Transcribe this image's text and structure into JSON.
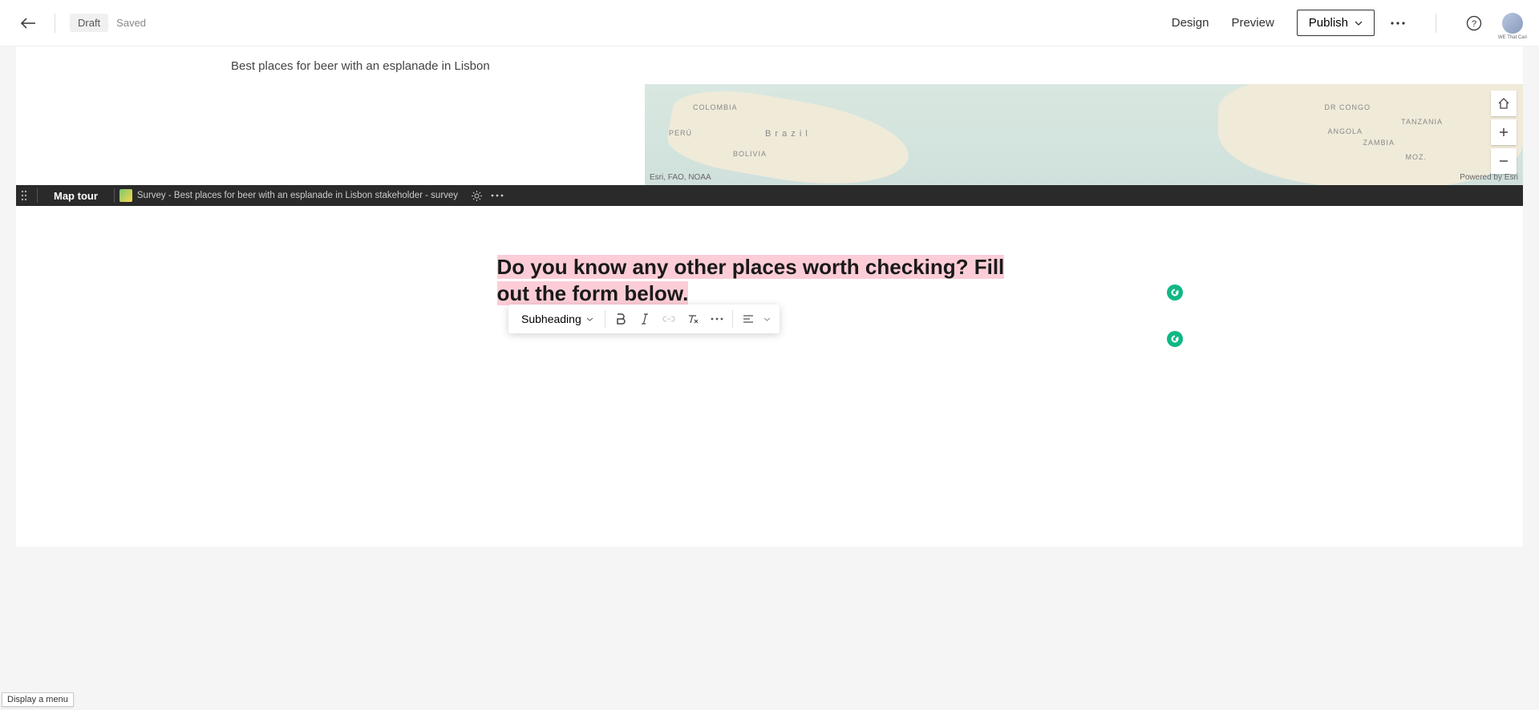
{
  "topbar": {
    "draft_label": "Draft",
    "saved_label": "Saved",
    "design_label": "Design",
    "preview_label": "Preview",
    "publish_label": "Publish",
    "avatar_caption": "WE That Can"
  },
  "story": {
    "title": "Best places for beer with an esplanade in Lisbon"
  },
  "map": {
    "labels": {
      "colombia": "COLOMBIA",
      "peru": "PERÚ",
      "bolivia": "BOLIVIA",
      "brazil": "B r a z i l",
      "drcongo": "DR CONGO",
      "angola": "ANGOLA",
      "zambia": "ZAMBIA",
      "tanzania": "TANZANIA",
      "moz": "MOZ."
    },
    "attribution": "Esri, FAO, NOAA",
    "powered": "Powered by Esri"
  },
  "block_toolbar": {
    "type_label": "Map tour",
    "survey_label": "Survey - Best places for beer with an esplanade in Lisbon stakeholder - survey"
  },
  "body": {
    "heading_text": "Do you know any other places worth checking? Fill out the form below."
  },
  "text_toolbar": {
    "style_label": "Subheading"
  },
  "tooltip": {
    "text": "Display a menu"
  }
}
